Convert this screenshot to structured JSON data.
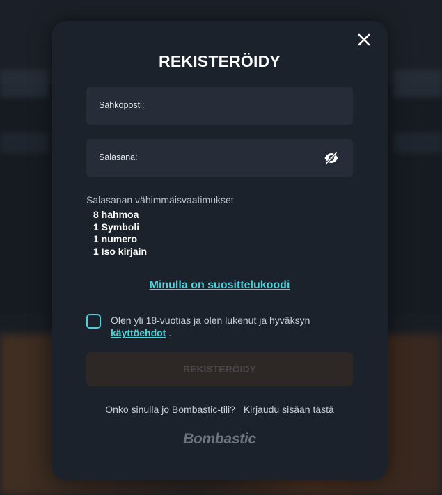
{
  "modal": {
    "title": "REKISTERÖIDY",
    "close_icon": "close-icon"
  },
  "form": {
    "email": {
      "label": "Sähköposti:",
      "value": "",
      "placeholder": ""
    },
    "password": {
      "label": "Salasana:",
      "value": "",
      "placeholder": "",
      "toggle_icon": "eye-hidden-icon"
    },
    "requirements": {
      "heading": "Salasanan vähimmäisvaatimukset",
      "items": [
        "8 hahmoa",
        "1 Symboli",
        "1 numero",
        "1 Iso kirjain"
      ]
    },
    "referral_link": "Minulla on suosittelukoodi",
    "terms": {
      "text": "Olen yli 18-vuotias ja olen lukenut ja hyväksyn",
      "link": "käyttöehdot",
      "suffix": " .",
      "checked": false
    },
    "submit_label": "REKISTERÖIDY"
  },
  "footer": {
    "question": "Onko sinulla jo Bombastic-tili?",
    "login_link": "Kirjaudu sisään tästä",
    "brand": "Bombastic"
  },
  "colors": {
    "accent": "#4fd1d9",
    "modal_bg": "#1c222b",
    "field_bg": "#262d38",
    "button_disabled_bg": "#2d2826"
  }
}
